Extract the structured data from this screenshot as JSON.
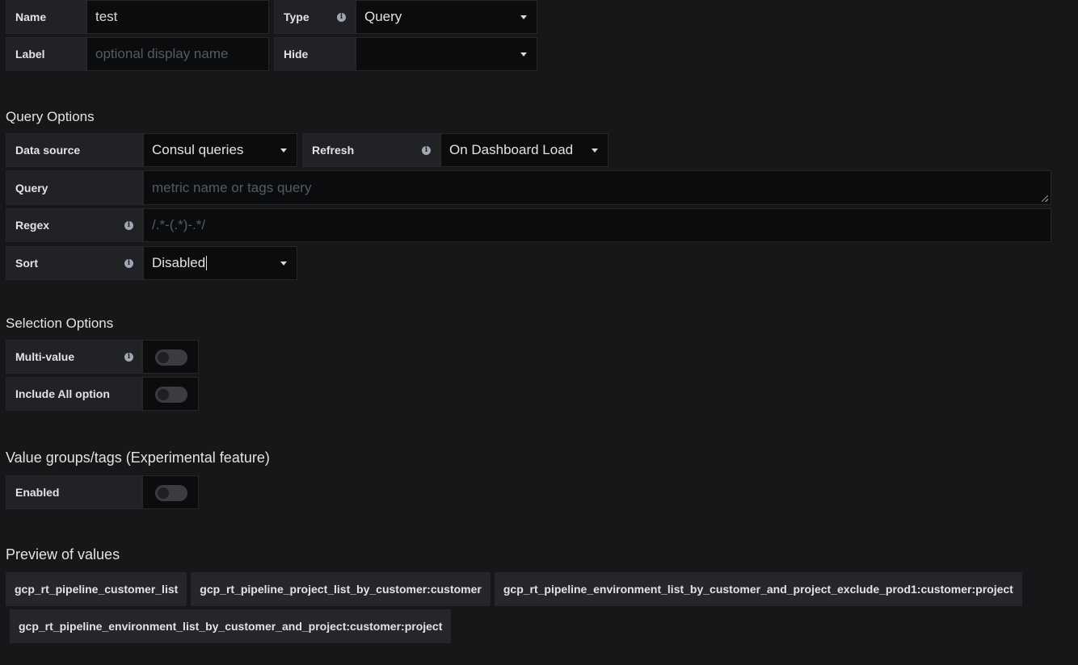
{
  "general": {
    "name_label": "Name",
    "name_value": "test",
    "type_label": "Type",
    "type_value": "Query",
    "label_label": "Label",
    "label_placeholder": "optional display name",
    "hide_label": "Hide",
    "hide_value": ""
  },
  "query_options": {
    "title": "Query Options",
    "datasource_label": "Data source",
    "datasource_value": "Consul queries",
    "refresh_label": "Refresh",
    "refresh_value": "On Dashboard Load",
    "query_label": "Query",
    "query_placeholder": "metric name or tags query",
    "regex_label": "Regex",
    "regex_placeholder": "/.*-(.*)-.*/",
    "sort_label": "Sort",
    "sort_value": "Disabled"
  },
  "selection_options": {
    "title": "Selection Options",
    "multi_value_label": "Multi-value",
    "multi_value_on": false,
    "include_all_label": "Include All option",
    "include_all_on": false
  },
  "value_groups": {
    "title": "Value groups/tags (Experimental feature)",
    "enabled_label": "Enabled",
    "enabled_on": false
  },
  "preview": {
    "title": "Preview of values",
    "values": [
      "gcp_rt_pipeline_customer_list",
      "gcp_rt_pipeline_project_list_by_customer:customer",
      "gcp_rt_pipeline_environment_list_by_customer_and_project_exclude_prod1:customer:project",
      "gcp_rt_pipeline_environment_list_by_customer_and_project:customer:project"
    ]
  },
  "colors": {
    "background": "#161719",
    "label_bg": "#202226",
    "input_bg": "#0b0c0e",
    "tag_bg": "#25272b",
    "text": "#d8d9da"
  }
}
